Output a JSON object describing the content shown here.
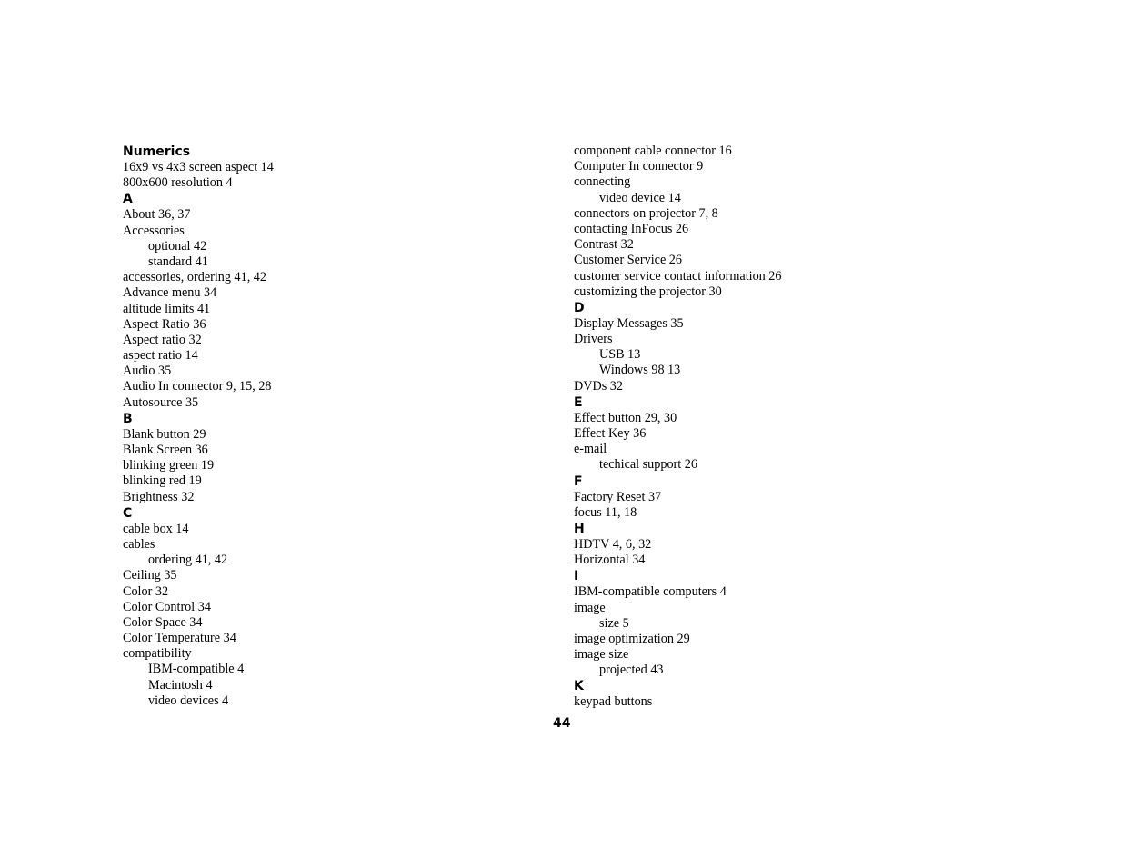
{
  "index_left": [
    {
      "type": "head",
      "text": "Numerics"
    },
    {
      "type": "entry",
      "text": "16x9 vs 4x3 screen aspect 14"
    },
    {
      "type": "entry",
      "text": "800x600 resolution 4"
    },
    {
      "type": "head",
      "text": "A"
    },
    {
      "type": "entry",
      "text": "About 36, 37"
    },
    {
      "type": "entry",
      "text": "Accessories"
    },
    {
      "type": "sub",
      "text": "optional 42"
    },
    {
      "type": "sub",
      "text": "standard 41"
    },
    {
      "type": "entry",
      "text": "accessories, ordering 41, 42"
    },
    {
      "type": "entry",
      "text": "Advance menu 34"
    },
    {
      "type": "entry",
      "text": "altitude limits 41"
    },
    {
      "type": "entry",
      "text": "Aspect Ratio 36"
    },
    {
      "type": "entry",
      "text": "Aspect ratio 32"
    },
    {
      "type": "entry",
      "text": "aspect ratio 14"
    },
    {
      "type": "entry",
      "text": "Audio 35"
    },
    {
      "type": "entry",
      "text": "Audio In connector 9, 15, 28"
    },
    {
      "type": "entry",
      "text": "Autosource 35"
    },
    {
      "type": "head",
      "text": "B"
    },
    {
      "type": "entry",
      "text": "Blank button 29"
    },
    {
      "type": "entry",
      "text": "Blank Screen 36"
    },
    {
      "type": "entry",
      "text": "blinking green 19"
    },
    {
      "type": "entry",
      "text": "blinking red 19"
    },
    {
      "type": "entry",
      "text": "Brightness 32"
    },
    {
      "type": "head",
      "text": "C"
    },
    {
      "type": "entry",
      "text": "cable box 14"
    },
    {
      "type": "entry",
      "text": "cables"
    },
    {
      "type": "sub",
      "text": "ordering 41, 42"
    },
    {
      "type": "entry",
      "text": "Ceiling 35"
    },
    {
      "type": "entry",
      "text": "Color 32"
    },
    {
      "type": "entry",
      "text": "Color Control 34"
    },
    {
      "type": "entry",
      "text": "Color Space 34"
    },
    {
      "type": "entry",
      "text": "Color Temperature 34"
    },
    {
      "type": "entry",
      "text": "compatibility"
    },
    {
      "type": "sub",
      "text": "IBM-compatible 4"
    },
    {
      "type": "sub",
      "text": "Macintosh 4"
    },
    {
      "type": "sub",
      "text": "video devices 4"
    }
  ],
  "index_right": [
    {
      "type": "entry",
      "text": "component cable connector 16"
    },
    {
      "type": "entry",
      "text": "Computer In connector 9"
    },
    {
      "type": "entry",
      "text": "connecting"
    },
    {
      "type": "sub",
      "text": "video device 14"
    },
    {
      "type": "entry",
      "text": "connectors on projector 7, 8"
    },
    {
      "type": "entry",
      "text": "contacting InFocus 26"
    },
    {
      "type": "entry",
      "text": "Contrast 32"
    },
    {
      "type": "entry",
      "text": "Customer Service 26"
    },
    {
      "type": "entry",
      "text": "customer service contact information 26"
    },
    {
      "type": "entry",
      "text": "customizing the projector 30"
    },
    {
      "type": "head",
      "text": "D"
    },
    {
      "type": "entry",
      "text": "Display Messages 35"
    },
    {
      "type": "entry",
      "text": "Drivers"
    },
    {
      "type": "sub",
      "text": "USB 13"
    },
    {
      "type": "sub",
      "text": "Windows 98 13"
    },
    {
      "type": "entry",
      "text": "DVDs 32"
    },
    {
      "type": "head",
      "text": "E"
    },
    {
      "type": "entry",
      "text": "Effect button 29, 30"
    },
    {
      "type": "entry",
      "text": "Effect Key 36"
    },
    {
      "type": "entry",
      "text": "e-mail"
    },
    {
      "type": "sub",
      "text": "techical support 26"
    },
    {
      "type": "head",
      "text": "F"
    },
    {
      "type": "entry",
      "text": "Factory Reset 37"
    },
    {
      "type": "entry",
      "text": "focus 11, 18"
    },
    {
      "type": "head",
      "text": "H"
    },
    {
      "type": "entry",
      "text": "HDTV 4, 6, 32"
    },
    {
      "type": "entry",
      "text": "Horizontal 34"
    },
    {
      "type": "head",
      "text": "I"
    },
    {
      "type": "entry",
      "text": "IBM-compatible computers 4"
    },
    {
      "type": "entry",
      "text": "image"
    },
    {
      "type": "sub",
      "text": "size 5"
    },
    {
      "type": "entry",
      "text": "image optimization 29"
    },
    {
      "type": "entry",
      "text": "image size"
    },
    {
      "type": "sub",
      "text": "projected 43"
    },
    {
      "type": "head",
      "text": "K"
    },
    {
      "type": "entry",
      "text": "keypad buttons"
    }
  ],
  "page_number": "44"
}
